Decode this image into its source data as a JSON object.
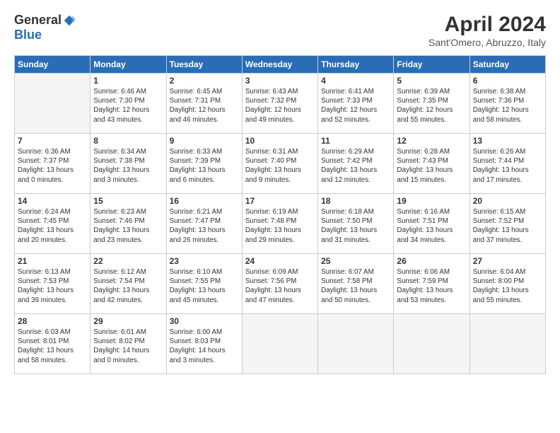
{
  "logo": {
    "general": "General",
    "blue": "Blue"
  },
  "title": "April 2024",
  "subtitle": "Sant'Omero, Abruzzo, Italy",
  "days_header": [
    "Sunday",
    "Monday",
    "Tuesday",
    "Wednesday",
    "Thursday",
    "Friday",
    "Saturday"
  ],
  "weeks": [
    [
      {
        "day": "",
        "info": ""
      },
      {
        "day": "1",
        "info": "Sunrise: 6:46 AM\nSunset: 7:30 PM\nDaylight: 12 hours\nand 43 minutes."
      },
      {
        "day": "2",
        "info": "Sunrise: 6:45 AM\nSunset: 7:31 PM\nDaylight: 12 hours\nand 46 minutes."
      },
      {
        "day": "3",
        "info": "Sunrise: 6:43 AM\nSunset: 7:32 PM\nDaylight: 12 hours\nand 49 minutes."
      },
      {
        "day": "4",
        "info": "Sunrise: 6:41 AM\nSunset: 7:33 PM\nDaylight: 12 hours\nand 52 minutes."
      },
      {
        "day": "5",
        "info": "Sunrise: 6:39 AM\nSunset: 7:35 PM\nDaylight: 12 hours\nand 55 minutes."
      },
      {
        "day": "6",
        "info": "Sunrise: 6:38 AM\nSunset: 7:36 PM\nDaylight: 12 hours\nand 58 minutes."
      }
    ],
    [
      {
        "day": "7",
        "info": "Sunrise: 6:36 AM\nSunset: 7:37 PM\nDaylight: 13 hours\nand 0 minutes."
      },
      {
        "day": "8",
        "info": "Sunrise: 6:34 AM\nSunset: 7:38 PM\nDaylight: 13 hours\nand 3 minutes."
      },
      {
        "day": "9",
        "info": "Sunrise: 6:33 AM\nSunset: 7:39 PM\nDaylight: 13 hours\nand 6 minutes."
      },
      {
        "day": "10",
        "info": "Sunrise: 6:31 AM\nSunset: 7:40 PM\nDaylight: 13 hours\nand 9 minutes."
      },
      {
        "day": "11",
        "info": "Sunrise: 6:29 AM\nSunset: 7:42 PM\nDaylight: 13 hours\nand 12 minutes."
      },
      {
        "day": "12",
        "info": "Sunrise: 6:28 AM\nSunset: 7:43 PM\nDaylight: 13 hours\nand 15 minutes."
      },
      {
        "day": "13",
        "info": "Sunrise: 6:26 AM\nSunset: 7:44 PM\nDaylight: 13 hours\nand 17 minutes."
      }
    ],
    [
      {
        "day": "14",
        "info": "Sunrise: 6:24 AM\nSunset: 7:45 PM\nDaylight: 13 hours\nand 20 minutes."
      },
      {
        "day": "15",
        "info": "Sunrise: 6:23 AM\nSunset: 7:46 PM\nDaylight: 13 hours\nand 23 minutes."
      },
      {
        "day": "16",
        "info": "Sunrise: 6:21 AM\nSunset: 7:47 PM\nDaylight: 13 hours\nand 26 minutes."
      },
      {
        "day": "17",
        "info": "Sunrise: 6:19 AM\nSunset: 7:48 PM\nDaylight: 13 hours\nand 29 minutes."
      },
      {
        "day": "18",
        "info": "Sunrise: 6:18 AM\nSunset: 7:50 PM\nDaylight: 13 hours\nand 31 minutes."
      },
      {
        "day": "19",
        "info": "Sunrise: 6:16 AM\nSunset: 7:51 PM\nDaylight: 13 hours\nand 34 minutes."
      },
      {
        "day": "20",
        "info": "Sunrise: 6:15 AM\nSunset: 7:52 PM\nDaylight: 13 hours\nand 37 minutes."
      }
    ],
    [
      {
        "day": "21",
        "info": "Sunrise: 6:13 AM\nSunset: 7:53 PM\nDaylight: 13 hours\nand 39 minutes."
      },
      {
        "day": "22",
        "info": "Sunrise: 6:12 AM\nSunset: 7:54 PM\nDaylight: 13 hours\nand 42 minutes."
      },
      {
        "day": "23",
        "info": "Sunrise: 6:10 AM\nSunset: 7:55 PM\nDaylight: 13 hours\nand 45 minutes."
      },
      {
        "day": "24",
        "info": "Sunrise: 6:09 AM\nSunset: 7:56 PM\nDaylight: 13 hours\nand 47 minutes."
      },
      {
        "day": "25",
        "info": "Sunrise: 6:07 AM\nSunset: 7:58 PM\nDaylight: 13 hours\nand 50 minutes."
      },
      {
        "day": "26",
        "info": "Sunrise: 6:06 AM\nSunset: 7:59 PM\nDaylight: 13 hours\nand 53 minutes."
      },
      {
        "day": "27",
        "info": "Sunrise: 6:04 AM\nSunset: 8:00 PM\nDaylight: 13 hours\nand 55 minutes."
      }
    ],
    [
      {
        "day": "28",
        "info": "Sunrise: 6:03 AM\nSunset: 8:01 PM\nDaylight: 13 hours\nand 58 minutes."
      },
      {
        "day": "29",
        "info": "Sunrise: 6:01 AM\nSunset: 8:02 PM\nDaylight: 14 hours\nand 0 minutes."
      },
      {
        "day": "30",
        "info": "Sunrise: 6:00 AM\nSunset: 8:03 PM\nDaylight: 14 hours\nand 3 minutes."
      },
      {
        "day": "",
        "info": ""
      },
      {
        "day": "",
        "info": ""
      },
      {
        "day": "",
        "info": ""
      },
      {
        "day": "",
        "info": ""
      }
    ]
  ]
}
